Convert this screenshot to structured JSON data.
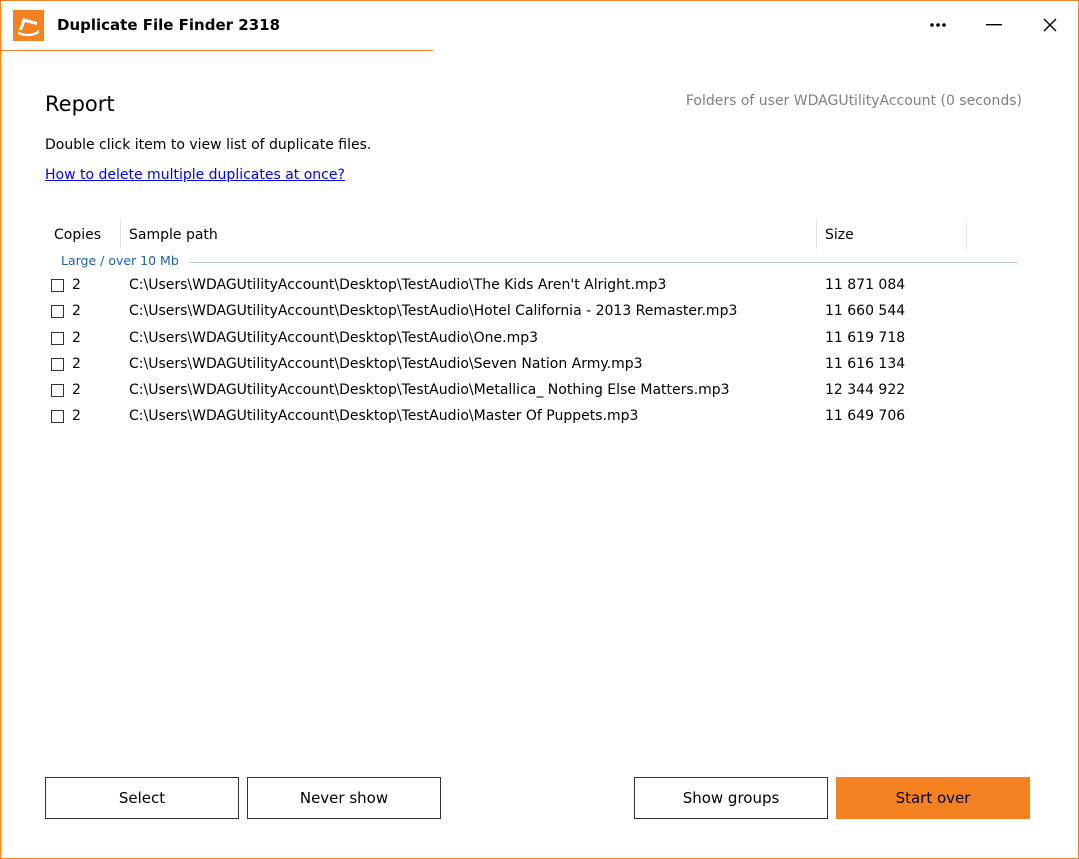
{
  "app": {
    "title": "Duplicate File Finder 2318",
    "accent_color": "#f58220",
    "logo_icon": "app-logo-icon"
  },
  "titlebar": {
    "more_icon": "more-dots-icon",
    "minimize_icon": "minimize-icon",
    "close_icon": "close-icon"
  },
  "report": {
    "title": "Report",
    "folders_info": "Folders of user WDAGUtilityAccount (0 seconds)",
    "instructions": "Double click item to view list of duplicate files.",
    "help_link": "How to delete multiple duplicates at once?"
  },
  "list": {
    "columns": [
      "Copies",
      "Sample path",
      "Size"
    ],
    "group_label": "Large / over 10 Mb",
    "rows": [
      {
        "checked": false,
        "copies": "2",
        "path": "C:\\Users\\WDAGUtilityAccount\\Desktop\\TestAudio\\The Kids Aren't Alright.mp3",
        "size": "11 871 084"
      },
      {
        "checked": false,
        "copies": "2",
        "path": "C:\\Users\\WDAGUtilityAccount\\Desktop\\TestAudio\\Hotel California - 2013 Remaster.mp3",
        "size": "11 660 544"
      },
      {
        "checked": false,
        "copies": "2",
        "path": "C:\\Users\\WDAGUtilityAccount\\Desktop\\TestAudio\\One.mp3",
        "size": "11 619 718"
      },
      {
        "checked": false,
        "copies": "2",
        "path": "C:\\Users\\WDAGUtilityAccount\\Desktop\\TestAudio\\Seven Nation Army.mp3",
        "size": "11 616 134"
      },
      {
        "checked": false,
        "copies": "2",
        "path": "C:\\Users\\WDAGUtilityAccount\\Desktop\\TestAudio\\Metallica_ Nothing Else Matters.mp3",
        "size": "12 344 922"
      },
      {
        "checked": false,
        "copies": "2",
        "path": "C:\\Users\\WDAGUtilityAccount\\Desktop\\TestAudio\\Master Of Puppets.mp3",
        "size": "11 649 706"
      }
    ]
  },
  "buttons": {
    "select": "Select",
    "never_show": "Never show",
    "show_groups": "Show groups",
    "start_over": "Start over"
  }
}
